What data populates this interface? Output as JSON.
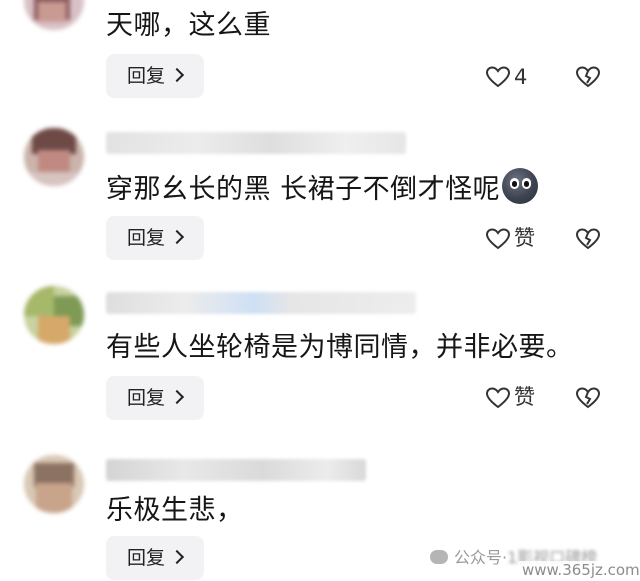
{
  "comments": [
    {
      "text": "天哪，这么重",
      "reply_label": "回复",
      "like_count": "4",
      "has_emoji": false
    },
    {
      "text": "穿那幺长的黑 长裙子不倒才怪呢",
      "reply_label": "回复",
      "like_count": "赞",
      "has_emoji": true
    },
    {
      "text": "有些人坐轮椅是为博同情，并非必要。",
      "reply_label": "回复",
      "like_count": "赞",
      "has_emoji": false
    },
    {
      "text": "乐极生悲，",
      "reply_label": "回复",
      "like_count": "",
      "has_emoji": false
    }
  ],
  "watermark": {
    "prefix": "公众号·",
    "blurred": "1影视口碑榜",
    "site": "www.365jz.com"
  },
  "icons": {
    "like": "heart-outline-icon",
    "dislike": "broken-heart-icon",
    "emoji": "dark-face-emoji-icon",
    "wechat": "wechat-icon"
  },
  "colors": {
    "reply_bg": "#f2f2f4",
    "text": "#161616",
    "muted": "#9a9a9a"
  }
}
